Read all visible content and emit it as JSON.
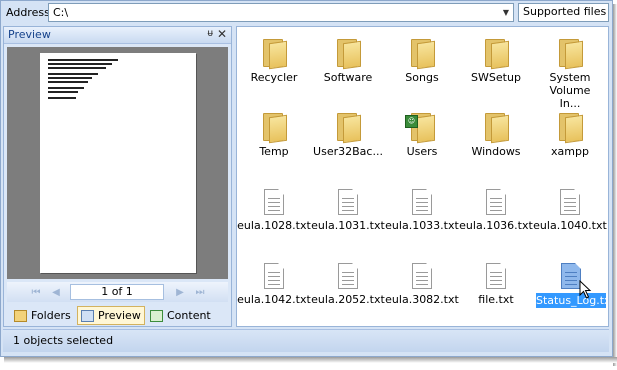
{
  "address": {
    "label": "Address",
    "value": "C:\\",
    "filter": "Supported files"
  },
  "preview_panel": {
    "title": "Preview",
    "pager": {
      "text": "1 of 1"
    },
    "tabs": [
      {
        "label": "Folders"
      },
      {
        "label": "Preview"
      },
      {
        "label": "Content"
      }
    ]
  },
  "files": [
    {
      "name": "Recycler",
      "kind": "folder"
    },
    {
      "name": "Software",
      "kind": "folder"
    },
    {
      "name": "Songs",
      "kind": "folder"
    },
    {
      "name": "SWSetup",
      "kind": "folder"
    },
    {
      "name": "System Volume In...",
      "kind": "folder"
    },
    {
      "name": "Temp",
      "kind": "folder"
    },
    {
      "name": "User32Bac...",
      "kind": "folder"
    },
    {
      "name": "Users",
      "kind": "folder"
    },
    {
      "name": "Windows",
      "kind": "folder"
    },
    {
      "name": "xampp",
      "kind": "folder"
    },
    {
      "name": "eula.1028.txt",
      "kind": "file"
    },
    {
      "name": "eula.1031.txt",
      "kind": "file"
    },
    {
      "name": "eula.1033.txt",
      "kind": "file"
    },
    {
      "name": "eula.1036.txt",
      "kind": "file"
    },
    {
      "name": "eula.1040.txt",
      "kind": "file"
    },
    {
      "name": "eula.1042.txt",
      "kind": "file"
    },
    {
      "name": "eula.2052.txt",
      "kind": "file"
    },
    {
      "name": "eula.3082.txt",
      "kind": "file"
    },
    {
      "name": "file.txt",
      "kind": "file"
    },
    {
      "name": "Status_Log.txt",
      "kind": "file",
      "selected": true
    }
  ],
  "status": {
    "text": "1 objects selected"
  },
  "colors": {
    "selection": "#3399ff",
    "folder": "#e8c25d",
    "chrome": "#d5e3f5"
  }
}
